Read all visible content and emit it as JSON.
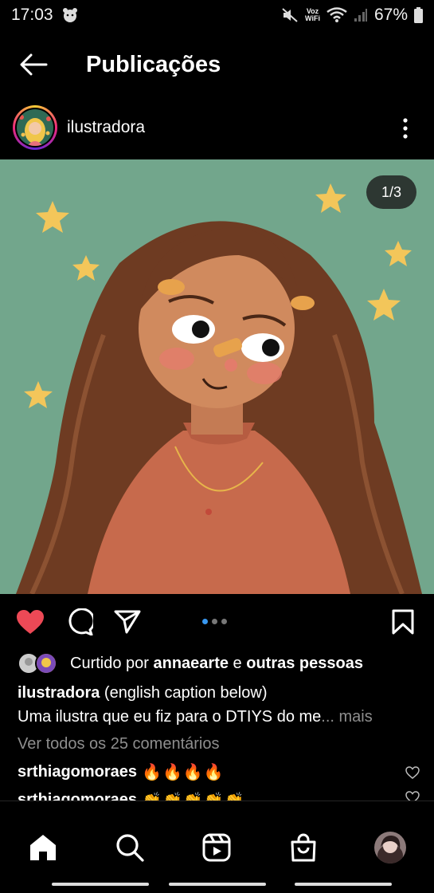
{
  "status_bar": {
    "time": "17:03",
    "voz_line1": "Voz",
    "voz_line2": "WiFi",
    "battery": "67%"
  },
  "header": {
    "title": "Publicações"
  },
  "post": {
    "username": "ilustradora",
    "image_counter": "1/3",
    "carousel": {
      "total": 3,
      "active": 1
    },
    "liked": true
  },
  "likes": {
    "prefix": "Curtido por ",
    "user": "annaearte",
    "conj": " e ",
    "others": "outras pessoas"
  },
  "caption": {
    "user": "ilustradora",
    "line1": " (english caption below)",
    "line2": "Uma ilustra que eu fiz para o DTIYS do me",
    "ellipsis": "...",
    "more": " mais"
  },
  "view_comments": "Ver todos os 25 comentários",
  "comments": [
    {
      "user": "srthiagomoraes",
      "text": "🔥🔥🔥🔥"
    },
    {
      "user": "srthiagomoraes",
      "text": "👏👏👏👏👏"
    }
  ],
  "colors": {
    "like": "#ed4956",
    "accent": "#3897f0",
    "image_bg": "#72a68c"
  }
}
